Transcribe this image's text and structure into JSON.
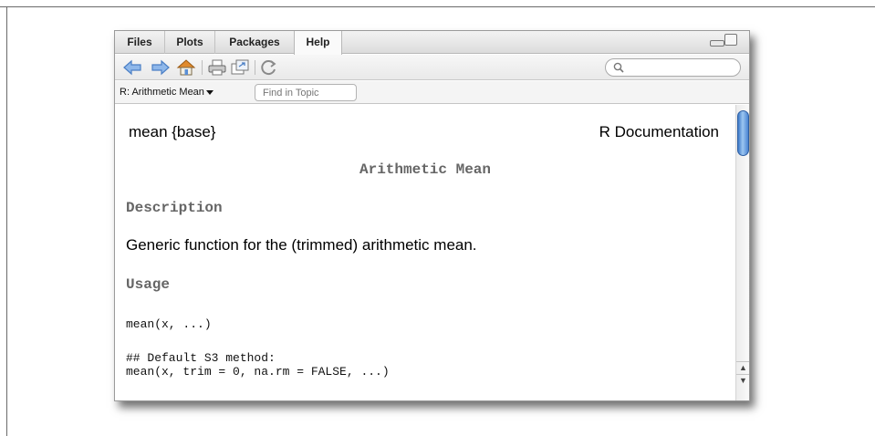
{
  "tabs": [
    {
      "label": "Files"
    },
    {
      "label": "Plots"
    },
    {
      "label": "Packages"
    },
    {
      "label": "Help",
      "active": true
    }
  ],
  "toolbar": {
    "icons": [
      "back-arrow-icon",
      "forward-arrow-icon",
      "home-icon",
      "print-icon",
      "open-in-new-window-icon",
      "refresh-icon"
    ],
    "search_value": ""
  },
  "topic": {
    "selected": "R: Arithmetic Mean",
    "find_placeholder": "Find in Topic"
  },
  "doc": {
    "header_left": "mean {base}",
    "header_right": "R Documentation",
    "title": "Arithmetic Mean",
    "description_heading": "Description",
    "description_text": "Generic function for the (trimmed) arithmetic mean.",
    "usage_heading": "Usage",
    "usage_line1": "mean(x, ...)",
    "usage_line2": "## Default S3 method:",
    "usage_line3": "mean(x, trim = 0, na.rm = FALSE, ...)"
  },
  "colors": {
    "heading": "#666666",
    "scroll_thumb": "#4a84d2",
    "nav_arrow": "#5a8fd6",
    "home_icon": "#d08a2a"
  }
}
